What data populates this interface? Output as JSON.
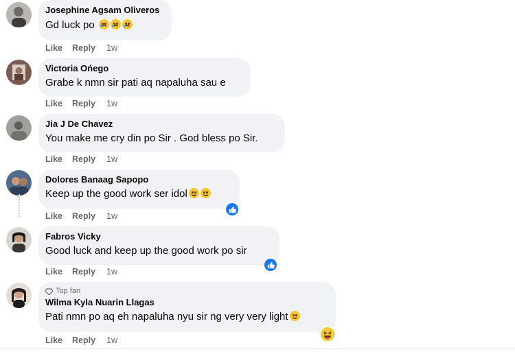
{
  "comments": [
    {
      "name": "Josephine Agsam Oliveros",
      "text": "Gd luck po",
      "like": "Like",
      "reply": "Reply",
      "time": "1w"
    },
    {
      "name": "Victoria Ońego",
      "text": "Grabe k nmn sir pati aq napaluha sau e",
      "like": "Like",
      "reply": "Reply",
      "time": "1w"
    },
    {
      "name": "Jia J De Chavez",
      "text": "You make me cry din po Sir . God bless po Sir.",
      "like": "Like",
      "reply": "Reply",
      "time": "1w"
    },
    {
      "name": "Dolores Banaag Sapopo",
      "text": "Keep up the good work ser idol",
      "like": "Like",
      "reply": "Reply",
      "time": "1w"
    },
    {
      "name": "Fabros Vicky",
      "text": "Good luck and keep up the good work po sir",
      "like": "Like",
      "reply": "Reply",
      "time": "1w"
    },
    {
      "badge": "Top fan",
      "name": "Wilma Kyla Nuarin Llagas",
      "text": "Pati nmn po aq eh napaluha nyu sir ng very very light",
      "like": "Like",
      "reply": "Reply",
      "time": "1w"
    }
  ],
  "icons": {
    "reaction_like": "thumbs-up-icon",
    "reaction_haha": "laughing-face-icon",
    "top_fan": "diamond-icon"
  },
  "colors": {
    "bubble": "#f0f2f5",
    "meta": "#65676b",
    "like_blue": "#1877f2"
  }
}
